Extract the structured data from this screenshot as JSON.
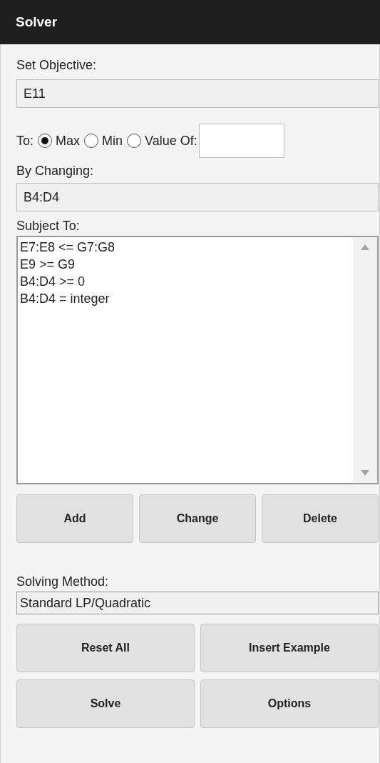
{
  "header": {
    "title": "Solver"
  },
  "objective": {
    "label": "Set Objective:",
    "value": "E11"
  },
  "to": {
    "label": "To:",
    "options": [
      {
        "label": "Max",
        "selected": true
      },
      {
        "label": "Min",
        "selected": false
      },
      {
        "label": "Value Of:",
        "selected": false
      }
    ]
  },
  "changing": {
    "label": "By Changing:",
    "value": "B4:D4"
  },
  "subject_to": {
    "label": "Subject To:",
    "items": [
      "E7:E8 <= G7:G8",
      "E9 >= G9",
      "B4:D4 >= 0",
      "B4:D4 = integer"
    ]
  },
  "constraint_buttons": [
    "Add",
    "Change",
    "Delete"
  ],
  "method": {
    "label": "Solving Method:",
    "value": "Standard LP/Quadratic"
  },
  "buttons_1": [
    "Reset All",
    "Insert Example"
  ],
  "buttons_2": [
    "Solve",
    "Options"
  ]
}
